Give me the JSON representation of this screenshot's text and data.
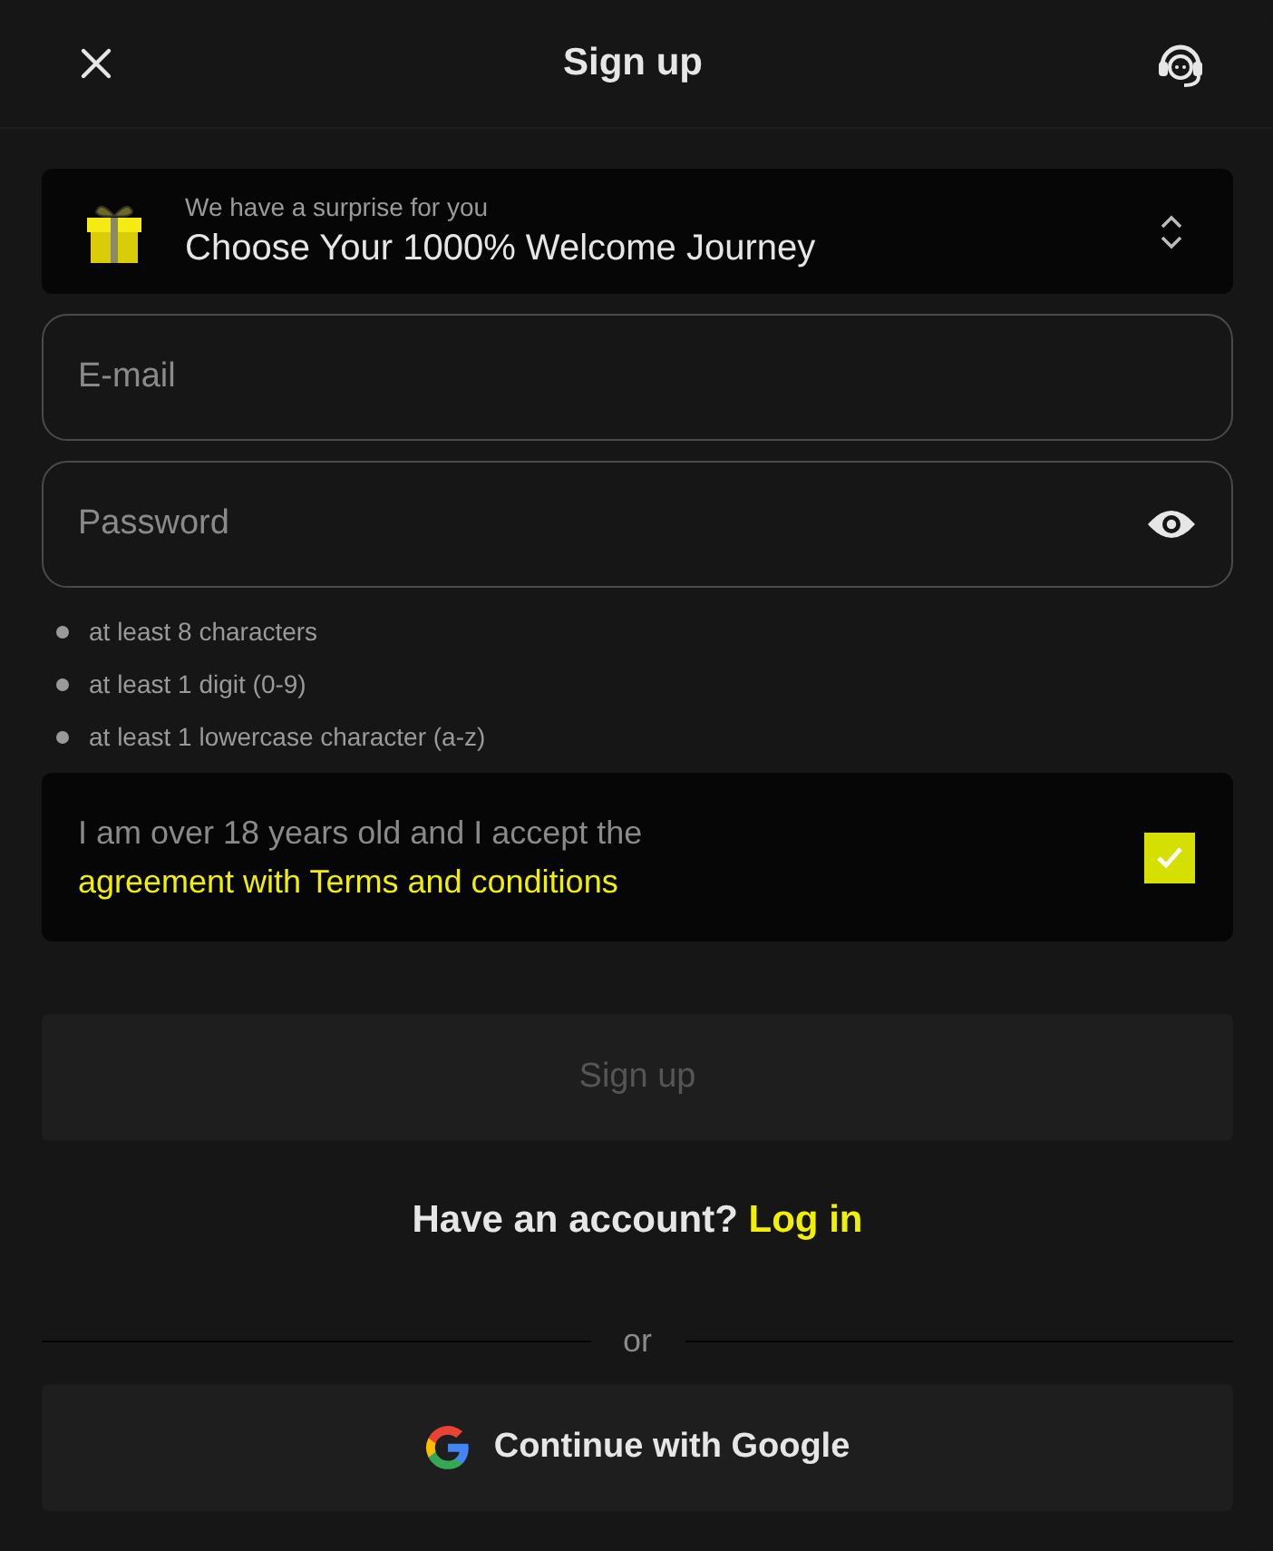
{
  "header": {
    "title": "Sign up"
  },
  "promo": {
    "caption": "We have a surprise for you",
    "title": "Choose Your 1000% Welcome Journey"
  },
  "email": {
    "placeholder": "E-mail"
  },
  "password": {
    "placeholder": "Password"
  },
  "password_rules": [
    {
      "text": "at least 8 characters",
      "met": false
    },
    {
      "text": "at least 1 digit (0-9)",
      "met": false
    },
    {
      "text": "at least 1 lowercase character (a-z)",
      "met": false
    }
  ],
  "agreement": {
    "text": "I am over 18 years old and I accept the",
    "link": "agreement with Terms and conditions",
    "checked": true
  },
  "signup_button": {
    "label": "Sign up",
    "disabled": true
  },
  "login_prompt": {
    "text": "Have an account?",
    "link": "Log in"
  },
  "divider": "or",
  "google_button": {
    "label": "Continue with Google"
  }
}
